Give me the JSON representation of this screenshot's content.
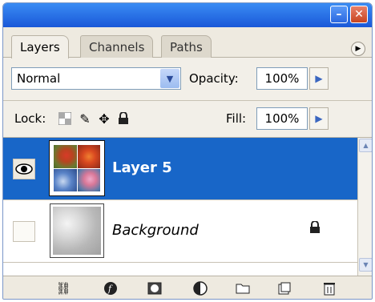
{
  "window": {
    "minimize_glyph": "–",
    "close_glyph": "✕"
  },
  "tabs": [
    {
      "label": "Layers"
    },
    {
      "label": "Channels"
    },
    {
      "label": "Paths"
    }
  ],
  "blend_mode": {
    "value": "Normal"
  },
  "opacity": {
    "label": "Opacity:",
    "value": "100%"
  },
  "lock": {
    "label": "Lock:"
  },
  "fill": {
    "label": "Fill:",
    "value": "100%"
  },
  "layers": [
    {
      "name": "Layer 5",
      "visible": true,
      "selected": true
    },
    {
      "name": "Background",
      "visible": false,
      "locked": true
    }
  ],
  "bottom_toolbar": {
    "icons": [
      "link-layers-icon",
      "layer-style-icon",
      "layer-mask-icon",
      "adjustment-layer-icon",
      "new-group-icon",
      "new-layer-icon",
      "delete-layer-icon"
    ]
  },
  "colors": {
    "selection": "#1866c8",
    "titlebar": "#1a58d8"
  }
}
